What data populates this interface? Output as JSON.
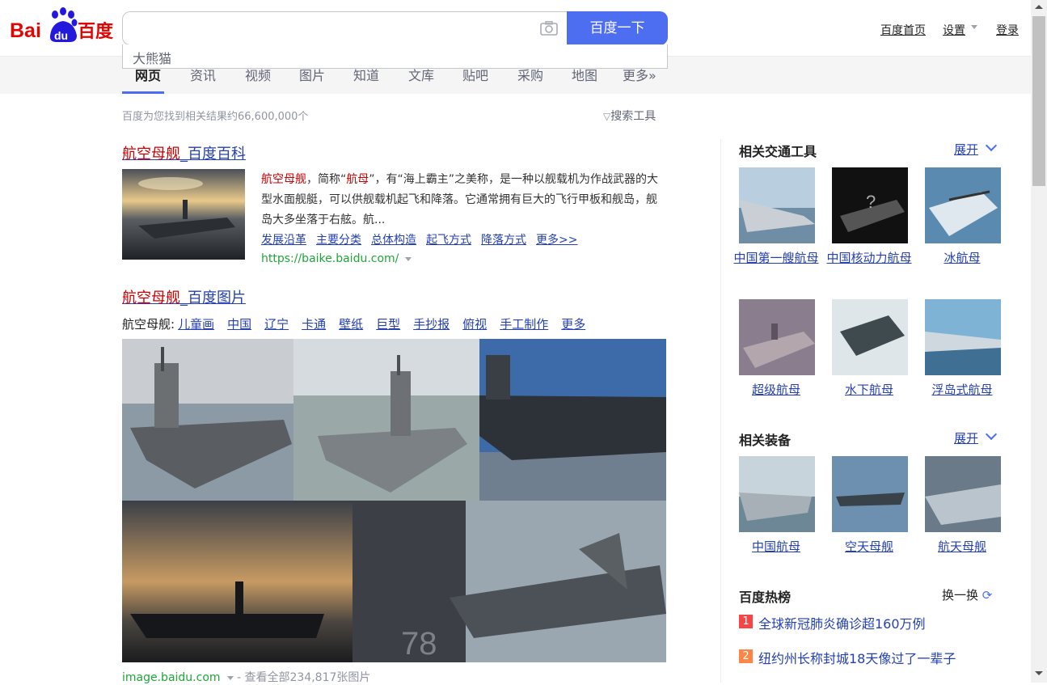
{
  "header": {
    "logo_text_1": "Bai",
    "logo_text_2": "du",
    "logo_text_3": "百度",
    "search_value": "",
    "search_button": "百度一下",
    "suggestion": "大熊猫",
    "links": [
      "百度首页",
      "设置",
      "登录"
    ]
  },
  "tabs": [
    "网页",
    "资讯",
    "视频",
    "图片",
    "知道",
    "文库",
    "贴吧",
    "采购",
    "地图",
    "更多»"
  ],
  "stats": "百度为您找到相关结果约66,600,000个",
  "tools": "搜索工具",
  "result1": {
    "title_em": "航空母舰",
    "title_rest": "_百度百科",
    "abstract_parts": [
      "航空母舰",
      "，简称“",
      "航母",
      "”，有“海上霸主”之美称，是一种以舰载机为作战武器的大型水面舰艇，可以供舰载机起飞和降落。它通常拥有巨大的飞行甲板和舰岛，舰岛大多坐落于右舷。航..."
    ],
    "links": [
      "发展沿革",
      "主要分类",
      "总体构造",
      "起飞方式",
      "降落方式",
      "更多>>"
    ],
    "url": "https://baike.baidu.com/"
  },
  "result2": {
    "title_em": "航空母舰",
    "title_rest": "_百度图片",
    "tag_label": "航空母舰:",
    "tags": [
      "儿童画",
      "中国",
      "辽宁",
      "卡通",
      "壁纸",
      "巨型",
      "手抄报",
      "俯视",
      "手工制作",
      "更多"
    ],
    "url": "image.baidu.com",
    "url_suffix": "- 查看全部234,817张图片"
  },
  "sidebar": {
    "transport": {
      "title": "相关交通工具",
      "expand": "展开",
      "items": [
        "中国第一艘航母",
        "中国核动力航母",
        "冰航母",
        "超级航母",
        "水下航母",
        "浮岛式航母"
      ]
    },
    "equipment": {
      "title": "相关装备",
      "expand": "展开",
      "items": [
        "中国航母",
        "空天母舰",
        "航天母舰"
      ]
    },
    "hot": {
      "title": "百度热榜",
      "refresh": "换一换",
      "items": [
        {
          "rank": "1",
          "text": "全球新冠肺炎确诊超160万例",
          "color": "#f54545"
        },
        {
          "rank": "2",
          "text": "纽约州长称封城18天像过了一辈子",
          "color": "#ff8547"
        }
      ]
    }
  },
  "colors": {
    "accent": "#4e6ef2",
    "link": "#2440b3",
    "highlight": "#c00",
    "url": "#20a53a"
  }
}
